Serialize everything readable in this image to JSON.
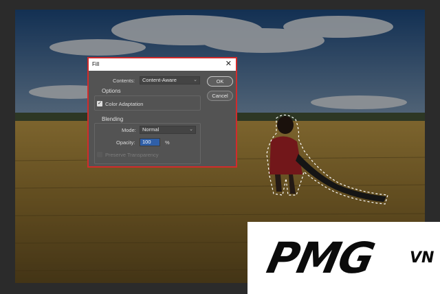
{
  "dialog": {
    "title": "Fill",
    "close_glyph": "✕",
    "contents_label": "Contents:",
    "contents_value": "Content-Aware",
    "options_title": "Options",
    "color_adaptation_label": "Color Adaptation",
    "color_adaptation_checked": true,
    "blending_title": "Blending",
    "mode_label": "Mode:",
    "mode_value": "Normal",
    "opacity_label": "Opacity:",
    "opacity_value": "100",
    "opacity_unit": "%",
    "preserve_transparency_label": "Preserve Transparency",
    "ok_label": "OK",
    "cancel_label": "Cancel"
  },
  "watermark": {
    "brand": "PMG",
    "suffix": "VN"
  },
  "colors": {
    "dialog_bg": "#535353",
    "highlight_border": "#d22b2b",
    "selected_input": "#2f5fa8",
    "logo_bg": "#ffffff"
  }
}
